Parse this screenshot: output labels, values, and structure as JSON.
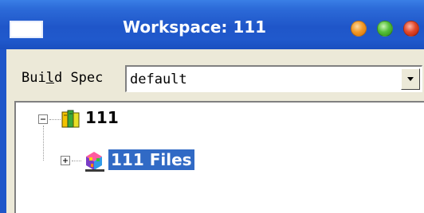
{
  "window": {
    "title": "Workspace: 111"
  },
  "build_spec": {
    "label": "Build Spec",
    "value": "default"
  },
  "tree": {
    "root": {
      "label": "111",
      "expanded": true,
      "icon": "workspace-icon"
    },
    "child": {
      "label": "111 Files",
      "expanded": false,
      "selected": true,
      "icon": "files-folder-icon"
    }
  },
  "colors": {
    "titlebar": "#2058cc",
    "selection": "#316ac5",
    "dialog": "#ece9d8"
  }
}
